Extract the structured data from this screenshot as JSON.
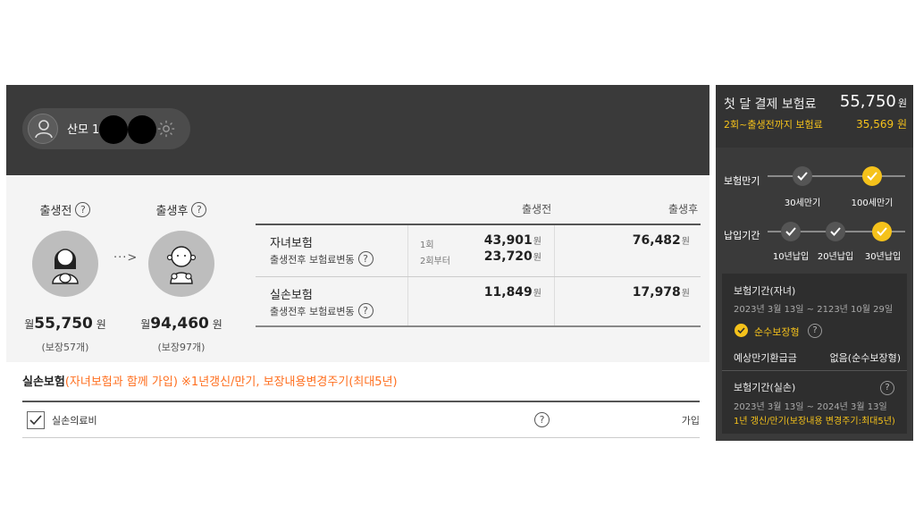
{
  "profile": {
    "name": "산모 1",
    "name_tail": "1"
  },
  "babies": {
    "before": {
      "label": "출생전",
      "premium_prefix": "월",
      "premium": "55,750",
      "unit": "원",
      "coverage": "(보장57개)"
    },
    "after": {
      "label": "출생후",
      "premium_prefix": "월",
      "premium": "94,460",
      "unit": "원",
      "coverage": "(보장97개)"
    },
    "arrow": "···>"
  },
  "table": {
    "col_before": "출생전",
    "col_after": "출생후",
    "rows": [
      {
        "name": "자녀보험",
        "sub": "출생전후 보험료변동",
        "tier1_label": "1회",
        "tier1_value": "43,901",
        "tier2_label": "2회부터",
        "tier2_value": "23,720",
        "after_value": "76,482",
        "unit": "원"
      },
      {
        "name": "실손보험",
        "sub": "출생전후 보험료변동",
        "before_value": "11,849",
        "after_value": "17,978",
        "unit": "원"
      }
    ]
  },
  "silson": {
    "title": "실손보험",
    "note": "(자녀보험과 함께 가입) ※1년갱신/만기, 보장내용변경주기(최대5년)",
    "item_name": "실손의료비",
    "item_status": "가입",
    "checked": true
  },
  "sidebar": {
    "first_label": "첫 달 결제 보험료",
    "first_value": "55,750",
    "first_unit": "원",
    "second_label": "2회~출생전까지 보험료",
    "second_value": "35,569 원",
    "maturity_label": "보험만기",
    "maturity_options": [
      "30세만기",
      "100세만기"
    ],
    "maturity_selected": "100세만기",
    "payment_label": "납입기간",
    "payment_options": [
      "10년납입",
      "20년납입",
      "30년납입"
    ],
    "payment_selected": "30년납입",
    "period_child_title": "보험기간(자녀)",
    "period_child_dates": "2023년 3월 13일   ~ 2123년 10월 29일",
    "pure_label": "순수보장형",
    "refund_label": "예상만기환급금",
    "refund_value": "없음(순수보장형)",
    "period_silson_title": "보험기간(실손)",
    "period_silson_dates": "2023년 3월 13일   ~   2024년 3월 13일",
    "period_silson_note": "1년 갱신/만기(보장내용 변경주기:최대5년)",
    "accent_color": "#f5c21b"
  }
}
